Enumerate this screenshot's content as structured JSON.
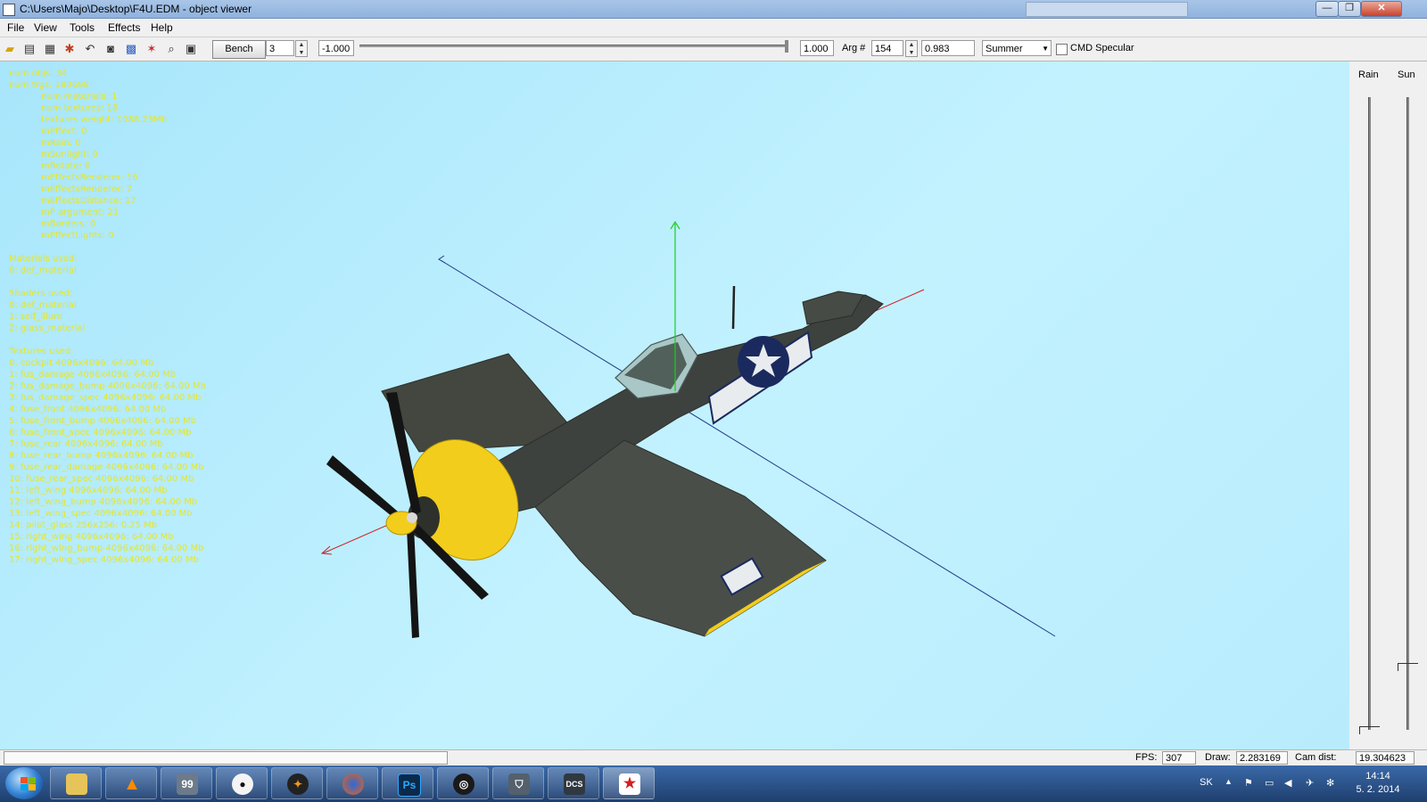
{
  "window": {
    "title": "C:\\Users\\Majo\\Desktop\\F4U.EDM - object viewer",
    "minimize_label": "—",
    "maximize_label": "❐",
    "close_label": "✕"
  },
  "menu": {
    "file": "File",
    "view": "View",
    "tools": "Tools",
    "effects": "Effects",
    "help": "Help"
  },
  "toolbar": {
    "bench_label": "Bench",
    "bench_value": "3",
    "range_min": "-1.000",
    "range_max": "1.000",
    "arg_label": "Arg #",
    "arg_value": "154",
    "arg_param": "0.983",
    "season_value": "Summer",
    "cmd_specular_label": "CMD Specular"
  },
  "info": {
    "lines": [
      "num objs: 34",
      "num trgs: 180698",
      "num materials: 1",
      "num textures: 18",
      "textures weight: 1088.25Mb",
      "mEffect: 0",
      "mRain: 0",
      "mSunlight: 0",
      "mRotate: 0",
      "mEffectsRenderer: 16",
      "mEffectsRenderer: 7",
      "mEffectsDistance: 17",
      "mP argument: 21",
      "mBorders: 0",
      "mEffectLights: 0",
      "Materials used:",
      "0: def_material",
      "Shaders used:",
      "0: def_material",
      "1: self_illum",
      "2: glass_material",
      "Textures used:",
      "0: cockpit 4096x4096: 64.00 Mb",
      "1: fus_damage 4096x4096: 64.00 Mb",
      "2: fus_damage_bump 4096x4096: 64.00 Mb",
      "3: fus_damage_spec 4096x4096: 64.00 Mb",
      "4: fuse_front 4096x4096: 64.00 Mb",
      "5: fuse_front_bump 4096x4096: 64.00 Mb",
      "6: fuse_front_spec 4096x4096: 64.00 Mb",
      "7: fuse_rear 4096x4096: 64.00 Mb",
      "8: fuse_rear_bump 4096x4096: 64.00 Mb",
      "9: fuse_rear_damage 4096x4096: 64.00 Mb",
      "10: fuse_rear_spec 4096x4096: 64.00 Mb",
      "11: left_wing 4096x4096: 64.00 Mb",
      "12: left_wing_bump 4096x4096: 64.00 Mb",
      "13: left_wing_spec 4096x4096: 64.00 Mb",
      "14: pilot_glass 256x256: 0.25 Mb",
      "15: right_wing 4096x4096: 64.00 Mb",
      "16: right_wing_bump 4096x4096: 64.00 Mb",
      "17: right_wing_spec 4096x4096: 64.00 Mb"
    ]
  },
  "right_panel": {
    "rain_label": "Rain",
    "sun_label": "Sun",
    "rain_level": 0.0,
    "sun_level": 0.1
  },
  "status": {
    "fps_label": "FPS:",
    "fps_value": "307",
    "draw_label": "Draw:",
    "draw_value": "2.283169",
    "cam_label": "Cam dist:",
    "cam_value": "19.304623"
  },
  "taskbar": {
    "apps": [
      "explorer-icon",
      "vlc-icon",
      "total-commander-icon",
      "panda-icon",
      "blender-icon",
      "firefox-icon",
      "photoshop-icon",
      "steam-icon",
      "shield-icon",
      "dcs-icon",
      "object-viewer-icon"
    ],
    "photoshop_text": "Ps",
    "tc_text": "99",
    "lang": "SK",
    "time": "14:14",
    "date": "5. 2. 2014"
  },
  "colors": {
    "viewport_bg": "#b8ecfd",
    "info_text": "#e6e62a",
    "aircraft_body": "#3d423f",
    "cowl": "#f2cd1c",
    "roundel": "#1b2a5e"
  }
}
